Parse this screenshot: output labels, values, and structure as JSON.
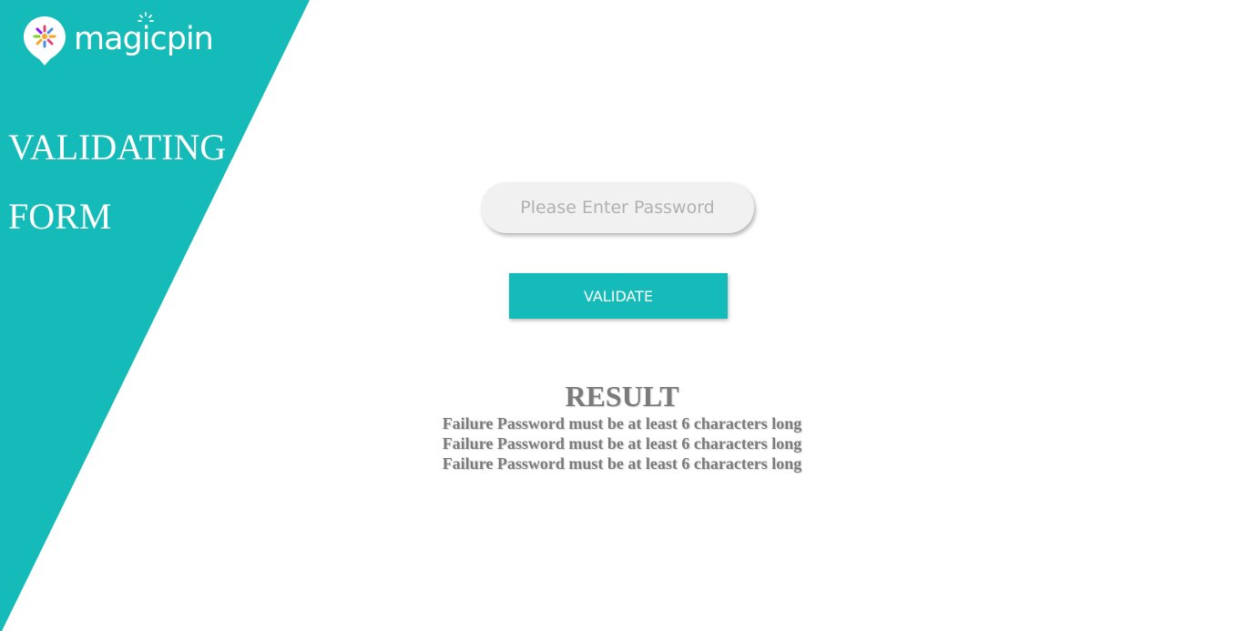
{
  "brand": {
    "name": "magicpin",
    "logo_icon": "map-pin-icon",
    "accent_color": "#14bbb9"
  },
  "hero": {
    "line1": "VALIDATING",
    "line2": "FORM"
  },
  "form": {
    "password_placeholder": "Please Enter Password",
    "password_value": "",
    "validate_label": "VALIDATE"
  },
  "result": {
    "title": "RESULT",
    "messages": [
      "Failure Password must be at least 6 characters long",
      "Failure Password must be at least 6 characters long",
      "Failure Password must be at least 6 characters long"
    ]
  }
}
